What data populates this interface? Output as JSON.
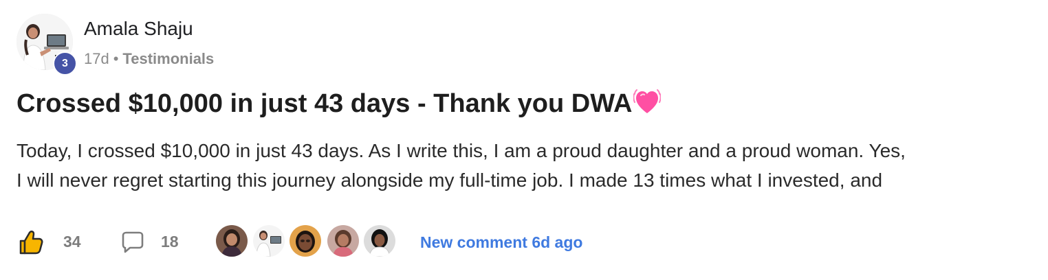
{
  "author": {
    "name": "Amala Shaju",
    "level": "3",
    "avatar_icon": "user-avatar-photo"
  },
  "meta": {
    "time_ago": "17d",
    "separator": "•",
    "category": "Testimonials"
  },
  "post": {
    "title": "Crossed $10,000 in just 43 days - Thank you DWA",
    "title_emoji": "heart-icon",
    "body_lines": [
      "Today, I crossed $10,000 in just 43 days. As I write this, I am a proud daughter and a proud woman. Yes,",
      "I will never regret starting this journey alongside my full-time job. I made 13 times what I invested, and"
    ]
  },
  "footer": {
    "like_icon": "thumbs-up-icon",
    "likes": "34",
    "comment_icon": "comment-bubble-icon",
    "comments": "18",
    "recent_commenters": [
      "commenter-avatar-1",
      "commenter-avatar-2",
      "commenter-avatar-3",
      "commenter-avatar-4",
      "commenter-avatar-5"
    ],
    "new_comment_text": "New comment 6d ago"
  },
  "colors": {
    "badge": "#4553a6",
    "link": "#3f7ae0",
    "meta_text": "#8a8a8a",
    "heart": "#ff4fa3"
  }
}
